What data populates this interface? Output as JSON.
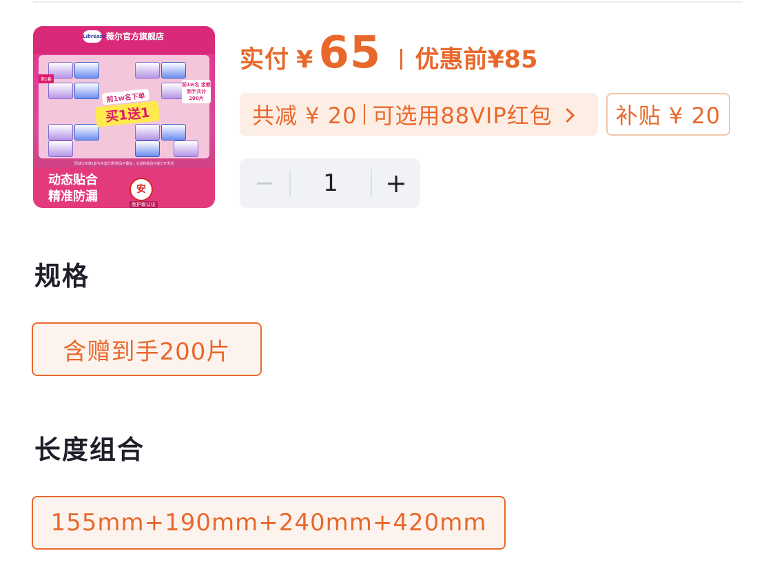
{
  "product_image": {
    "store_name": "薇尔官方旗舰店",
    "brand": "Libresse",
    "offer_top": "前1w名下单",
    "offer_main": "买1送1",
    "side_tag": "第1套",
    "right_tag": "前1w名 金额到手共计 200片",
    "fine_print": "同城订单满1套与多套优惠/赠品不叠加，主品和赠品可能分开发货",
    "slogan_line1": "动态贴合",
    "slogan_line2": "精准防漏",
    "seal_char": "安",
    "cert_label": "医护级认证"
  },
  "price": {
    "paid_label": "实付",
    "currency": "¥",
    "paid_value": "65",
    "original_label": "优惠前",
    "original_value": "¥85"
  },
  "discount": {
    "total_text": "共减 ¥ 20",
    "vip_text": "可选用88VIP红包",
    "subsidy_text": "补贴 ¥ 20"
  },
  "stepper": {
    "minus": "−",
    "value": "1",
    "plus": "+"
  },
  "spec_section": {
    "title": "规格",
    "options": [
      "含赠到手200片"
    ]
  },
  "length_section": {
    "title": "长度组合",
    "options": [
      "155mm+190mm+240mm+420mm"
    ]
  },
  "colors": {
    "accent": "#e8682b",
    "accent_light_bg": "#fdeee5",
    "stepper_bg": "#f0f2f6",
    "text_dark": "#1f1f2a"
  }
}
